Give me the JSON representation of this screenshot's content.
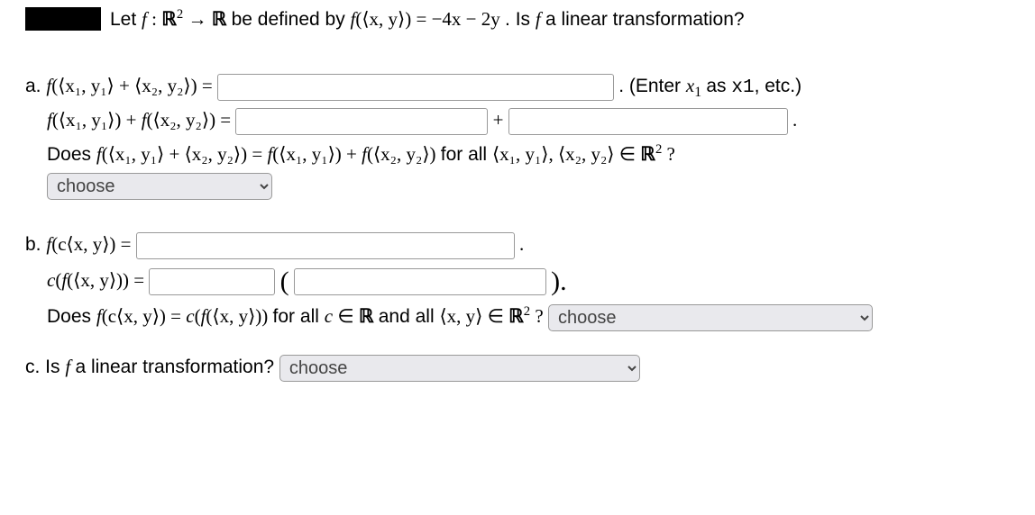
{
  "header": {
    "prefix_let": "Let ",
    "func": "f",
    "colon": " : ",
    "domain_open": "ℝ",
    "domain_sup": "2",
    "arrow": " → ",
    "codomain": "ℝ",
    "defined": " be defined by ",
    "f_of": "f",
    "arg": "(⟨x, y⟩)",
    "eq": " = ",
    "expr": "−4x − 2y",
    "tail": ". Is ",
    "f2": "f",
    "tail2": " a linear transformation?"
  },
  "a": {
    "label": "a. ",
    "line1_lhs_f": "f",
    "line1_lhs_arg": "(⟨x₁, y₁⟩ + ⟨x₂, y₂⟩) = ",
    "line1_hint": ". (Enter ",
    "line1_hint_x": "x",
    "line1_hint_sub": "1",
    "line1_hint_mid": " as ",
    "line1_hint_code": "x1",
    "line1_hint_end": ", etc.)",
    "line2_f1": "f",
    "line2_arg1": "(⟨x₁, y₁⟩) + ",
    "line2_f2": "f",
    "line2_arg2": "(⟨x₂, y₂⟩) = ",
    "plus": " + ",
    "dot": ".",
    "line3_pre": "Does ",
    "line3_f": "f",
    "line3_arg": "(⟨x₁, y₁⟩ + ⟨x₂, y₂⟩) = ",
    "line3_f2": "f",
    "line3_arg2": "(⟨x₁, y₁⟩) + ",
    "line3_f3": "f",
    "line3_arg3": "(⟨x₂, y₂⟩)",
    "line3_mid": " for all ",
    "line3_set": "⟨x₁, y₁⟩, ⟨x₂, y₂⟩ ∈ ",
    "line3_R": "ℝ",
    "line3_sup": "2",
    "line3_q": "?",
    "select_placeholder": "choose"
  },
  "b": {
    "label": "b. ",
    "line1_f": "f",
    "line1_arg": "(c⟨x, y⟩) = ",
    "dot": ".",
    "line2_c": "c",
    "line2_open": "(",
    "line2_f": "f",
    "line2_arg": "(⟨x, y⟩)) = ",
    "big_open": "(",
    "big_close": ").",
    "line3_pre": "Does ",
    "line3_f": "f",
    "line3_arg": "(c⟨x, y⟩) = ",
    "line3_c": "c",
    "line3_open": "(",
    "line3_f2": "f",
    "line3_arg2": "(⟨x, y⟩))",
    "line3_mid1": " for all ",
    "line3_cvar": "c",
    "line3_in1": " ∈ ",
    "line3_R1": "ℝ",
    "line3_mid2": " and all ",
    "line3_xy": "⟨x, y⟩ ∈ ",
    "line3_R2": "ℝ",
    "line3_sup": "2",
    "line3_q": "? ",
    "select_placeholder": "choose"
  },
  "c": {
    "label": "c. ",
    "text_pre": "Is ",
    "f": "f",
    "text_post": " a linear transformation? ",
    "select_placeholder": "choose"
  }
}
